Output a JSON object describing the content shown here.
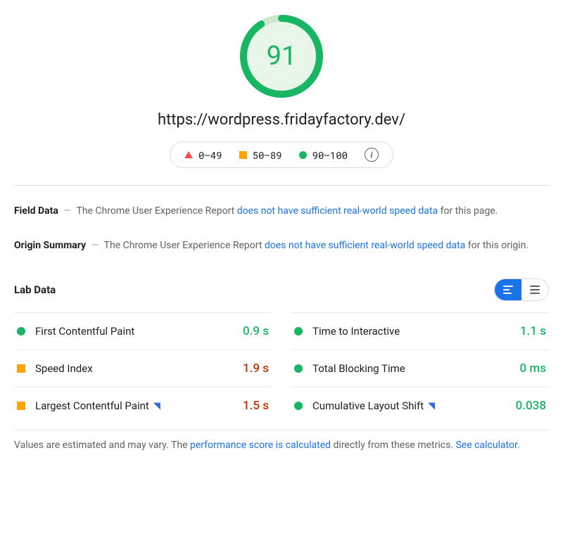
{
  "score": "91",
  "url": "https://wordpress.fridayfactory.dev/",
  "legend": {
    "bad": "0–49",
    "mid": "50–89",
    "good": "90–100"
  },
  "field_data": {
    "label": "Field Data",
    "prefix": "The Chrome User Experience Report ",
    "link": "does not have sufficient real-world speed data",
    "suffix": " for this page."
  },
  "origin_summary": {
    "label": "Origin Summary",
    "prefix": "The Chrome User Experience Report ",
    "link": "does not have sufficient real-world speed data",
    "suffix": " for this origin."
  },
  "lab": {
    "title": "Lab Data"
  },
  "metrics": {
    "fcp": {
      "name": "First Contentful Paint",
      "value": "0.9 s"
    },
    "tti": {
      "name": "Time to Interactive",
      "value": "1.1 s"
    },
    "si": {
      "name": "Speed Index",
      "value": "1.9 s"
    },
    "tbt": {
      "name": "Total Blocking Time",
      "value": "0 ms"
    },
    "lcp": {
      "name": "Largest Contentful Paint",
      "value": "1.5 s"
    },
    "cls": {
      "name": "Cumulative Layout Shift",
      "value": "0.038"
    }
  },
  "footnote": {
    "pre": "Values are estimated and may vary. The ",
    "link1": "performance score is calculated",
    "mid": " directly from these metrics. ",
    "link2": "See calculator."
  }
}
